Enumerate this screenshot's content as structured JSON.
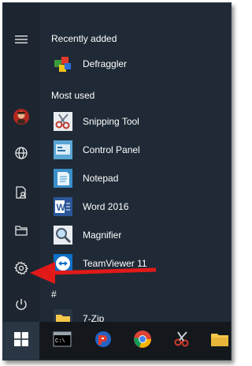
{
  "rail": {
    "items": [
      {
        "name": "hamburger-menu",
        "icon": "hamburger-icon"
      },
      {
        "name": "user-account",
        "icon": "avatar"
      },
      {
        "name": "network",
        "icon": "globe-icon"
      },
      {
        "name": "documents",
        "icon": "document-person-icon"
      },
      {
        "name": "file-explorer",
        "icon": "folder-icon"
      },
      {
        "name": "settings",
        "icon": "gear-icon"
      },
      {
        "name": "power",
        "icon": "power-icon"
      }
    ]
  },
  "sections": {
    "recently_added": "Recently added",
    "most_used": "Most used",
    "hash": "#"
  },
  "apps": {
    "defraggler": "Defraggler",
    "snipping_tool": "Snipping Tool",
    "control_panel": "Control Panel",
    "notepad": "Notepad",
    "word": "Word 2016",
    "magnifier": "Magnifier",
    "teamviewer": "TeamViewer 11",
    "seven_zip": "7-Zip"
  },
  "taskbar": {
    "items": [
      "windows-logo-icon",
      "terminal-icon",
      "app-icon",
      "chrome-icon",
      "snipping-icon",
      "folder-icon"
    ]
  },
  "colors": {
    "background": "#1f2a36",
    "taskbar": "#14181d",
    "arrow": "#e11919",
    "start_active": "#2a3644"
  }
}
